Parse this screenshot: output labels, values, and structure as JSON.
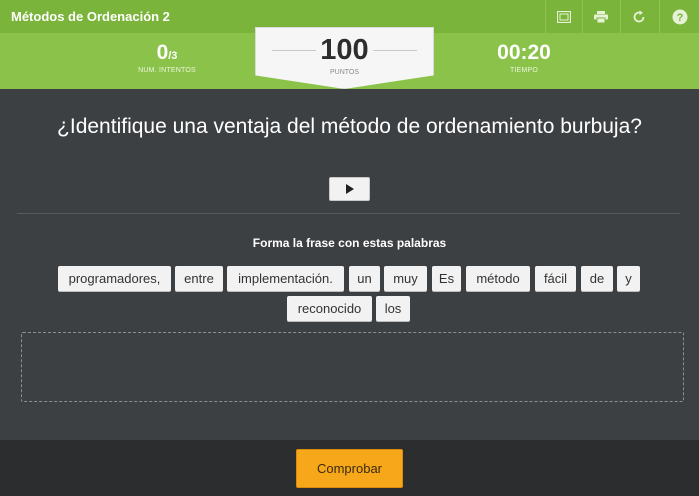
{
  "header": {
    "title": "Métodos de Ordenación 2",
    "buttons": [
      {
        "name": "fullscreen-icon"
      },
      {
        "name": "print-icon"
      },
      {
        "name": "reload-icon"
      },
      {
        "name": "help-icon"
      }
    ]
  },
  "stats": {
    "attempts_value": "0",
    "attempts_total": "/3",
    "attempts_label": "NUM. INTENTOS",
    "points_value": "100",
    "points_label": "PUNTOS",
    "time_value": "00:20",
    "time_label": "TIEMPO"
  },
  "question": {
    "text": "¿Identifique una ventaja del método de ordenamiento burbuja?"
  },
  "instruction": "Forma la frase con estas palabras",
  "words": [
    "programadores,",
    "entre",
    "implementación.",
    "un",
    "muy",
    "Es",
    "método",
    "fácil",
    "de",
    "y",
    "reconocido",
    "los"
  ],
  "footer": {
    "check_label": "Comprobar"
  },
  "colors": {
    "header_green": "#7ab43a",
    "score_green": "#8bc34a",
    "panel_dark": "#3d4043",
    "button_orange": "#f6a71a"
  }
}
